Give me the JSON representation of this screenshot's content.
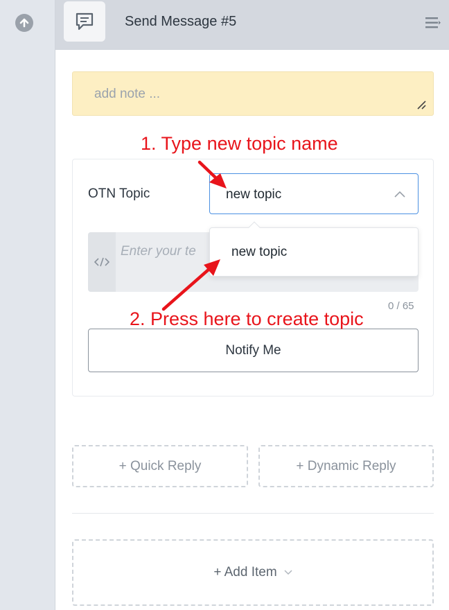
{
  "header": {
    "title": "Send Message #5"
  },
  "note": {
    "placeholder": "add note ..."
  },
  "otn": {
    "label": "OTN Topic",
    "select_value": "new topic",
    "dropdown_option": "new topic",
    "message_placeholder": "Enter your te",
    "counter": "0 / 65",
    "button_label": "Notify Me"
  },
  "actions": {
    "quick_reply": "+ Quick Reply",
    "dynamic_reply": "+ Dynamic Reply",
    "add_item": "+ Add Item"
  },
  "annotations": {
    "step1": "1. Type new topic name",
    "step2": "2. Press here to create topic",
    "color": "#e8141b"
  },
  "icons": {
    "rail": "arrow-up-circle-icon",
    "header": "message-icon",
    "menu": "menu-icon",
    "code": "code-icon"
  },
  "colors": {
    "note_bg": "#fdefc3",
    "focus_border": "#4a90e2",
    "header_bg": "#d4d8df"
  }
}
